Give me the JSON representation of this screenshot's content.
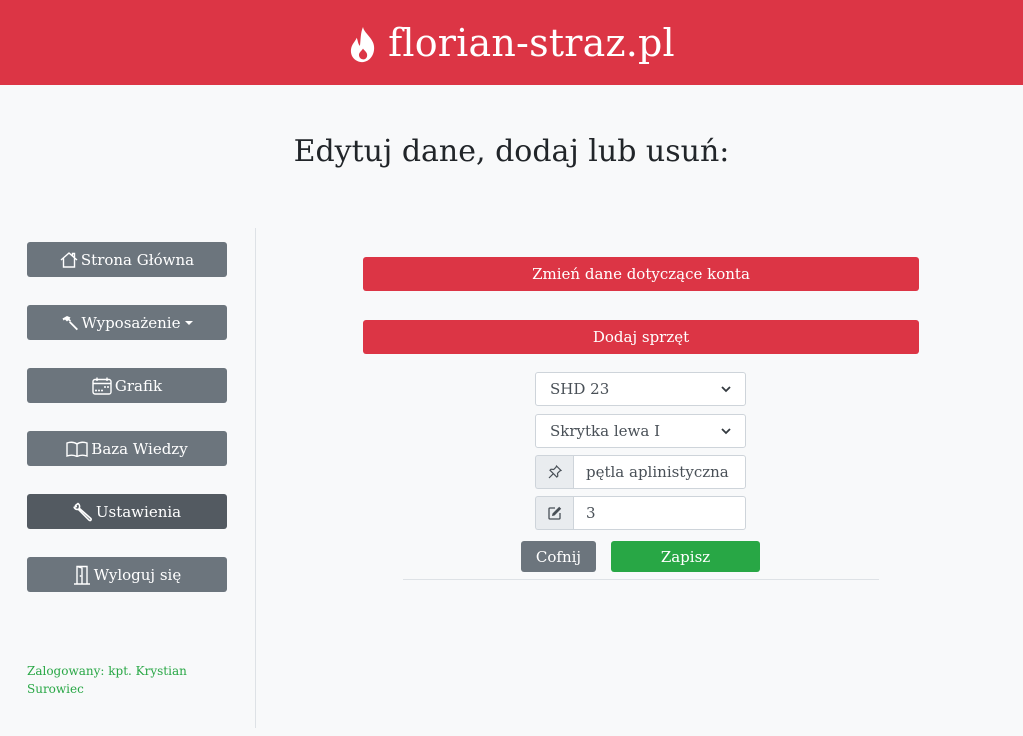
{
  "header": {
    "brand": "florian-straz.pl",
    "brand_icon": "flame-icon"
  },
  "page_title": "Edytuj dane, dodaj lub usuń:",
  "sidebar": {
    "items": [
      {
        "label": "Strona Główna",
        "icon": "home-icon"
      },
      {
        "label": "Wyposażenie",
        "icon": "hammer-icon",
        "dropdown": true
      },
      {
        "label": "Grafik",
        "icon": "calendar-icon"
      },
      {
        "label": "Baza Wiedzy",
        "icon": "book-icon"
      },
      {
        "label": "Ustawienia",
        "icon": "wrench-icon",
        "active": true
      },
      {
        "label": "Wyloguj się",
        "icon": "door-icon"
      }
    ],
    "logged_in": "Zalogowany: kpt. Krystian Surowiec"
  },
  "main": {
    "account_button": "Zmień dane dotyczące konta",
    "add_equipment_button": "Dodaj sprzęt",
    "vehicle_select": "SHD 23",
    "locker_select": "Skrytka lewa I",
    "item_name_value": "pętla aplinistyczna",
    "quantity_value": "3",
    "back_button": "Cofnij",
    "save_button": "Zapisz"
  },
  "colors": {
    "brand_red": "#dc3545",
    "secondary_gray": "#6c757d",
    "success_green": "#28a745",
    "background": "#f8f9fa"
  }
}
